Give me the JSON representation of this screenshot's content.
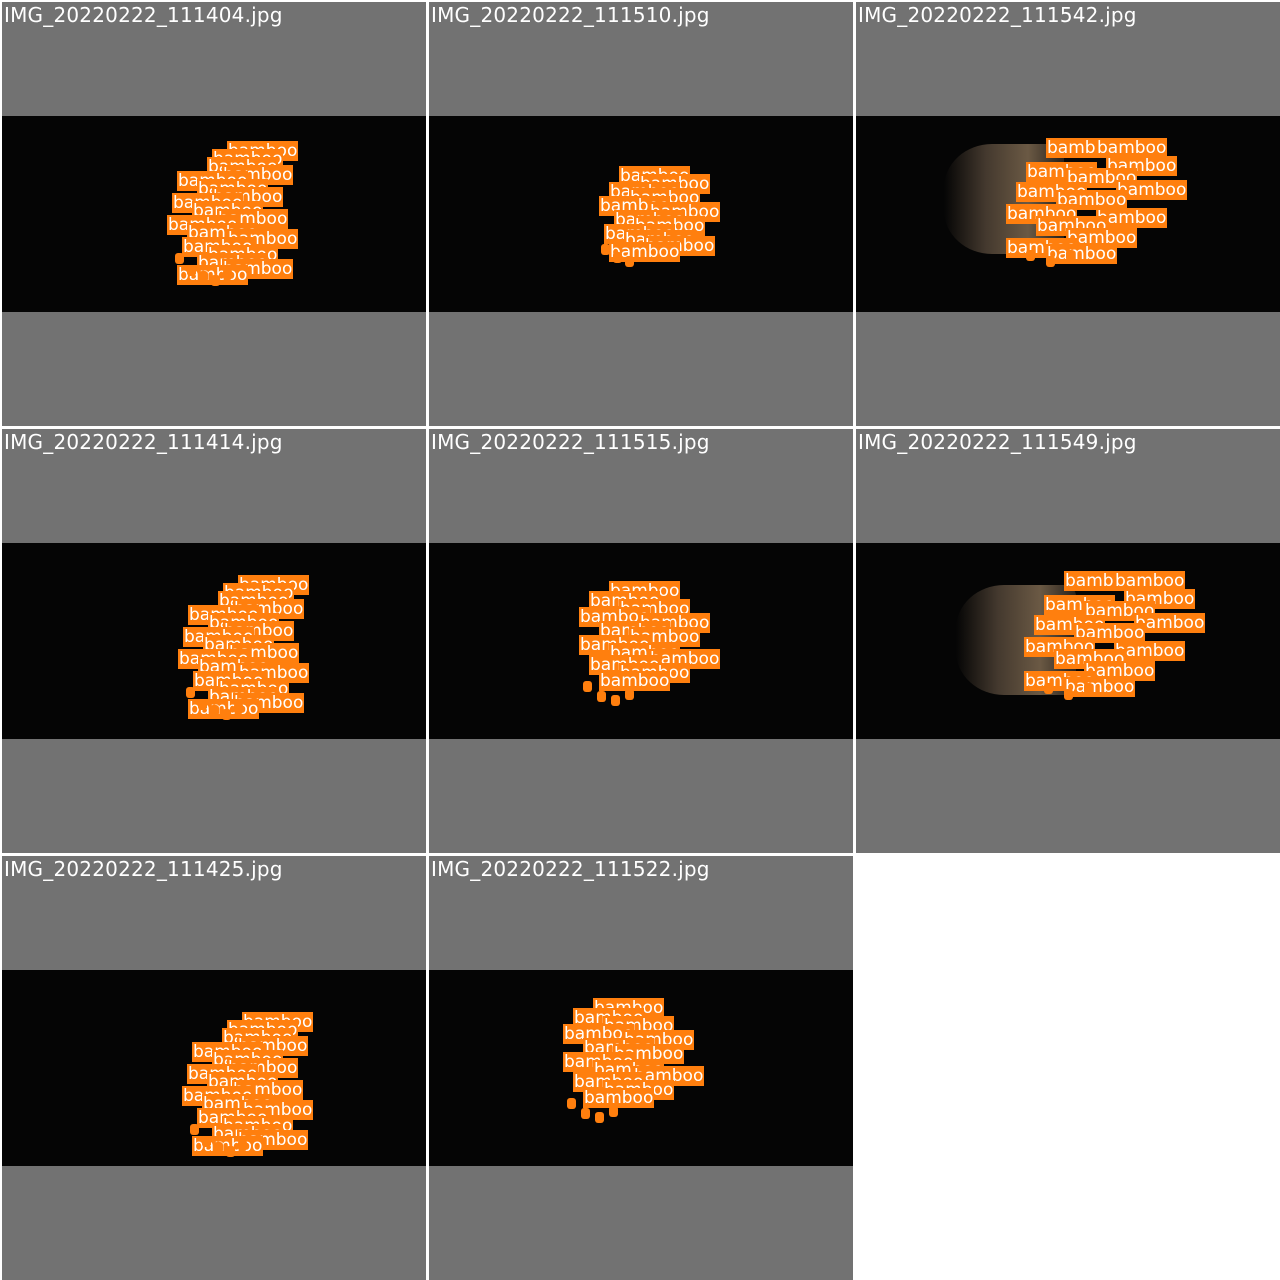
{
  "label_text": "bamboo",
  "label_color": "#ff7f0e",
  "tiles": [
    {
      "filename": "IMG_20220222_111404.jpg"
    },
    {
      "filename": "IMG_20220222_111510.jpg"
    },
    {
      "filename": "IMG_20220222_111542.jpg"
    },
    {
      "filename": "IMG_20220222_111414.jpg"
    },
    {
      "filename": "IMG_20220222_111515.jpg"
    },
    {
      "filename": "IMG_20220222_111549.jpg"
    },
    {
      "filename": "IMG_20220222_111425.jpg"
    },
    {
      "filename": "IMG_20220222_111522.jpg"
    }
  ]
}
